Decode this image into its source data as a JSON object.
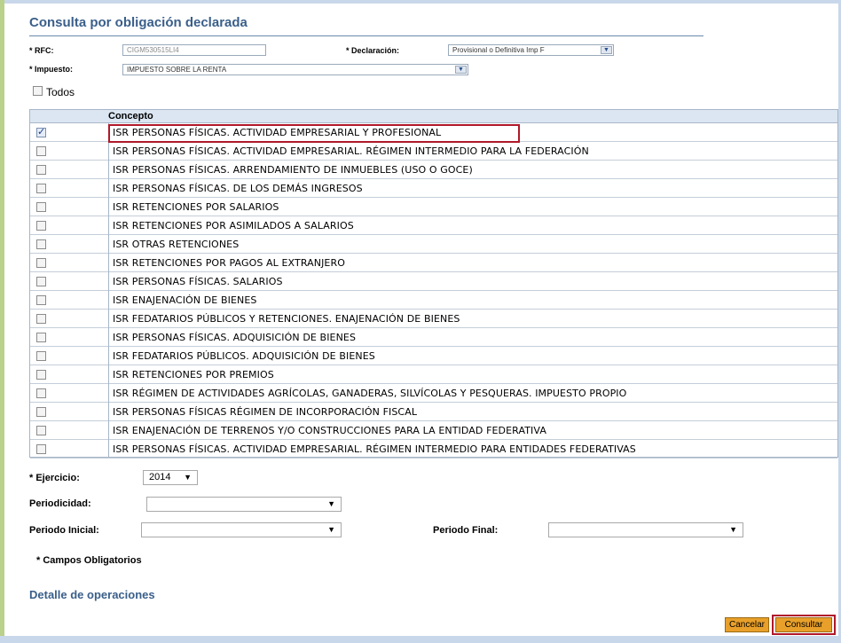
{
  "form": {
    "title": "Consulta por obligación declarada",
    "rfc_label": "* RFC:",
    "rfc_value": "CIGM530515LI4",
    "declaracion_label": "* Declaración:",
    "declaracion_value": "Provisional o Definitiva Imp F",
    "impuesto_label": "* Impuesto:",
    "impuesto_value": "IMPUESTO SOBRE LA RENTA",
    "todos_label": "Todos",
    "todos_checked": false
  },
  "grid": {
    "header": "Concepto",
    "rows": [
      {
        "label": "ISR PERSONAS FÍSICAS. ACTIVIDAD EMPRESARIAL Y PROFESIONAL",
        "checked": true
      },
      {
        "label": "ISR PERSONAS FÍSICAS. ACTIVIDAD EMPRESARIAL. RÉGIMEN INTERMEDIO PARA LA FEDERACIÓN",
        "checked": false
      },
      {
        "label": "ISR PERSONAS FÍSICAS. ARRENDAMIENTO DE INMUEBLES (USO O GOCE)",
        "checked": false
      },
      {
        "label": "ISR PERSONAS FÍSICAS. DE LOS DEMÁS INGRESOS",
        "checked": false
      },
      {
        "label": "ISR RETENCIONES POR SALARIOS",
        "checked": false
      },
      {
        "label": "ISR RETENCIONES POR ASIMILADOS A SALARIOS",
        "checked": false
      },
      {
        "label": "ISR OTRAS RETENCIONES",
        "checked": false
      },
      {
        "label": "ISR RETENCIONES POR PAGOS AL EXTRANJERO",
        "checked": false
      },
      {
        "label": "ISR PERSONAS FÍSICAS. SALARIOS",
        "checked": false
      },
      {
        "label": "ISR ENAJENACIÓN DE BIENES",
        "checked": false
      },
      {
        "label": "ISR FEDATARIOS PÚBLICOS Y RETENCIONES. ENAJENACIÓN DE BIENES",
        "checked": false
      },
      {
        "label": "ISR PERSONAS FÍSICAS. ADQUISICIÓN DE BIENES",
        "checked": false
      },
      {
        "label": "ISR FEDATARIOS PÚBLICOS. ADQUISICIÓN DE BIENES",
        "checked": false
      },
      {
        "label": "ISR RETENCIONES POR PREMIOS",
        "checked": false
      },
      {
        "label": "ISR RÉGIMEN DE ACTIVIDADES AGRÍCOLAS, GANADERAS, SILVÍCOLAS Y PESQUERAS. IMPUESTO PROPIO",
        "checked": false
      },
      {
        "label": "ISR PERSONAS FÍSICAS RÉGIMEN DE INCORPORACIÓN FISCAL",
        "checked": false
      },
      {
        "label": "ISR ENAJENACIÓN DE TERRENOS Y/O CONSTRUCCIONES PARA LA ENTIDAD FEDERATIVA",
        "checked": false
      },
      {
        "label": "ISR PERSONAS FÍSICAS. ACTIVIDAD EMPRESARIAL. RÉGIMEN INTERMEDIO PARA ENTIDADES FEDERATIVAS",
        "checked": false
      }
    ]
  },
  "filters": {
    "ejercicio_label": "* Ejercicio:",
    "ejercicio_value": "2014",
    "periodicidad_label": "Periodicidad:",
    "periodicidad_value": "",
    "periodo_inicial_label": "Periodo Inicial:",
    "periodo_inicial_value": "",
    "periodo_final_label": "Periodo Final:",
    "periodo_final_value": ""
  },
  "footer": {
    "required_note": "* Campos Obligatorios",
    "detail_link": "Detalle de operaciones",
    "cancel_label": "Cancelar",
    "submit_label": "Consultar"
  },
  "colors": {
    "title_blue": "#3a5f8a",
    "highlight_red": "#b0182a",
    "button_orange": "#e8a02a",
    "grid_header_bg": "#dce6f2"
  }
}
